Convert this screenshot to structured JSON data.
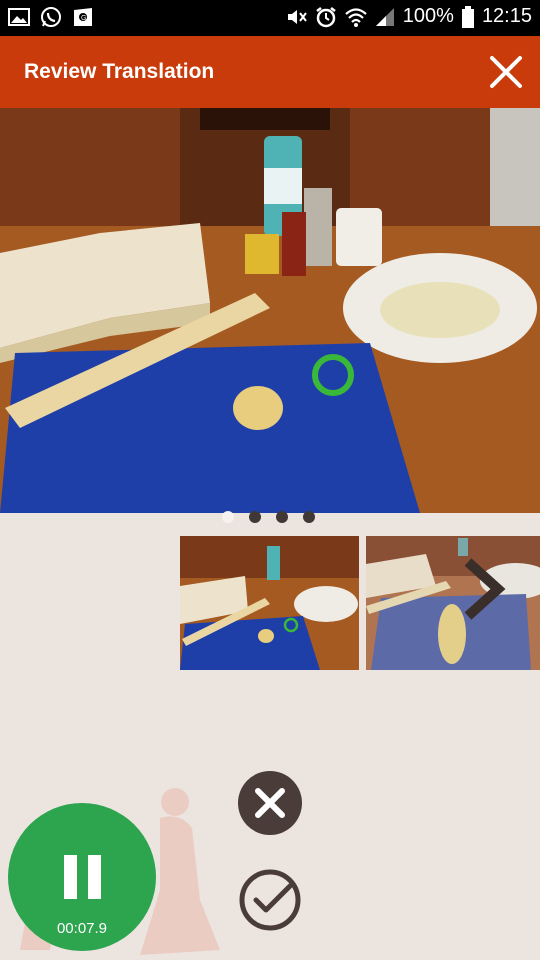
{
  "status_bar": {
    "battery": "100%",
    "time": "12:15"
  },
  "app_bar": {
    "title": "Review Translation"
  },
  "carousel": {
    "page_count": 4,
    "current_page": 1
  },
  "recorder": {
    "elapsed": "00:07.9",
    "state": "recording"
  },
  "colors": {
    "app_bar": "#c93b0a",
    "record_button": "#2da44e",
    "action_button": "#4a3c38",
    "background": "#ece4df"
  }
}
